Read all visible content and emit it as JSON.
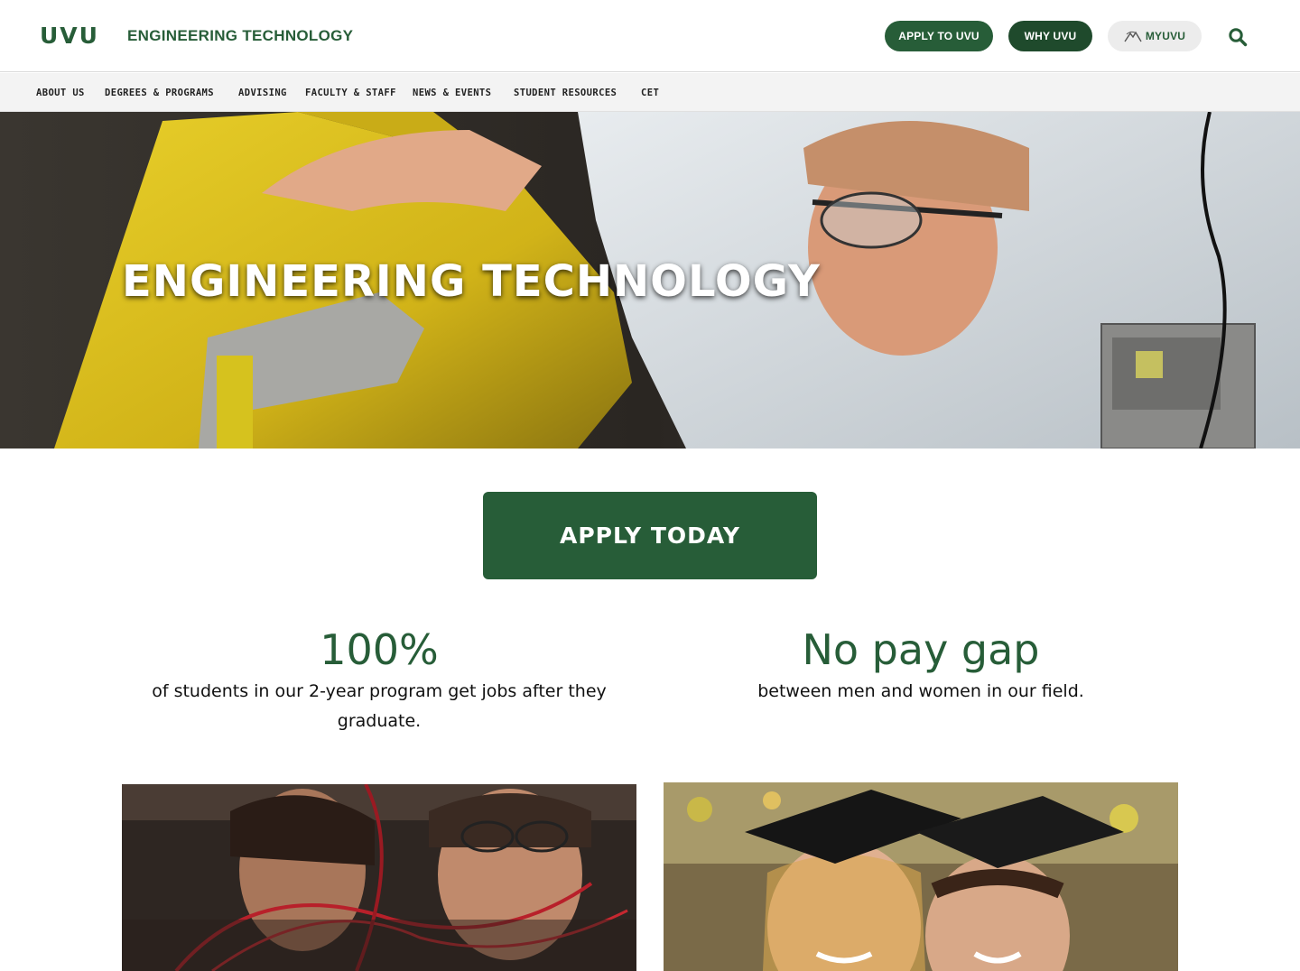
{
  "header": {
    "logo": "UVU",
    "site_title": "ENGINEERING TECHNOLOGY",
    "apply_button": "APPLY TO UVU",
    "why_button": "WHY UVU",
    "myuvu_button": "MYUVU",
    "search_icon": "search-icon"
  },
  "nav": {
    "items": [
      {
        "label": "ABOUT US"
      },
      {
        "label": "DEGREES & PROGRAMS"
      },
      {
        "label": "ADVISING"
      },
      {
        "label": "FACULTY & STAFF"
      },
      {
        "label": "NEWS & EVENTS"
      },
      {
        "label": "STUDENT RESOURCES"
      },
      {
        "label": "CET"
      }
    ]
  },
  "hero": {
    "title": "ENGINEERING TECHNOLOGY"
  },
  "cta": {
    "apply_today": "APPLY TODAY"
  },
  "stats": [
    {
      "value": "100%",
      "description": "of students in our 2-year program get jobs after they graduate."
    },
    {
      "value": "No pay gap",
      "description": "between men and women in our field."
    }
  ],
  "colors": {
    "brand_green": "#275d38",
    "dark_green": "#1f4a2c",
    "nav_bg": "#f3f3f3"
  }
}
